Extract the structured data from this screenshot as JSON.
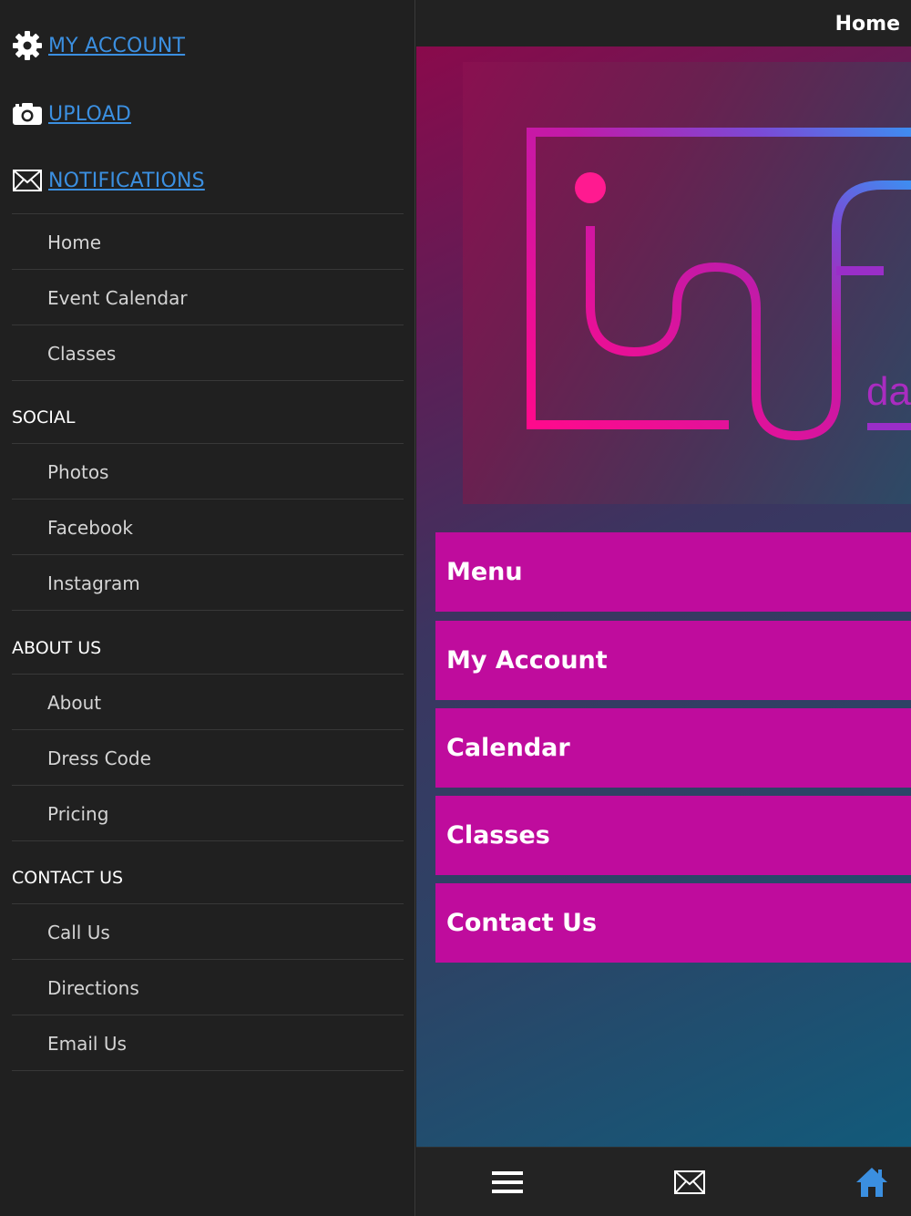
{
  "account_links": [
    {
      "label": "MY ACCOUNT",
      "icon": "gear-icon"
    },
    {
      "label": "UPLOAD",
      "icon": "camera-icon"
    },
    {
      "label": "NOTIFICATIONS",
      "icon": "envelope-icon"
    }
  ],
  "nav": {
    "main_items": [
      "Home",
      "Event Calendar",
      "Classes"
    ],
    "sections": [
      {
        "title": "SOCIAL",
        "items": [
          "Photos",
          "Facebook",
          "Instagram"
        ]
      },
      {
        "title": "ABOUT US",
        "items": [
          "About",
          "Dress Code",
          "Pricing"
        ]
      },
      {
        "title": "CONTACT US",
        "items": [
          "Call Us",
          "Directions",
          "Email Us"
        ]
      }
    ]
  },
  "header": {
    "title": "Home"
  },
  "logo": {
    "text": "da"
  },
  "menu_buttons": [
    "Menu",
    "My Account",
    "Calendar",
    "Classes",
    "Contact Us"
  ],
  "tabbar": {
    "items": [
      "menu-icon",
      "envelope-icon",
      "home-icon"
    ]
  },
  "colors": {
    "link": "#3b8fe0",
    "button": "#bf0c9d",
    "sidebar_bg": "#202020",
    "home_icon": "#3b8fe0"
  }
}
